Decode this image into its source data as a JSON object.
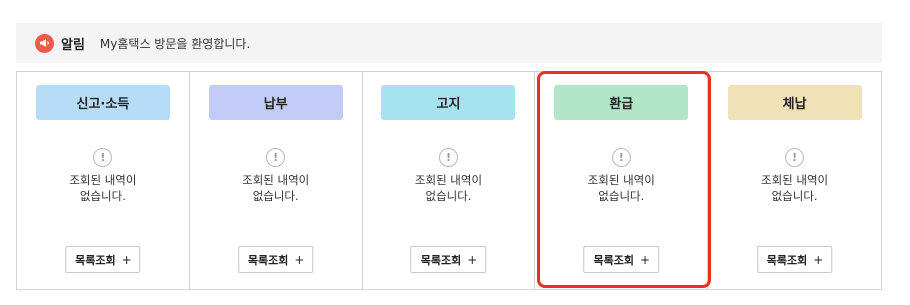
{
  "notice": {
    "icon": "megaphone-icon",
    "title": "알림",
    "message": "My홈택스 방문을 환영합니다."
  },
  "panels": [
    {
      "title": "신고·소득",
      "color": "#b7dcf7",
      "message_line1": "조회된 내역이",
      "message_line2": "없습니다.",
      "button": "목록조회",
      "button_plus": "+"
    },
    {
      "title": "납부",
      "color": "#c3ccf8",
      "message_line1": "조회된 내역이",
      "message_line2": "없습니다.",
      "button": "목록조회",
      "button_plus": "+"
    },
    {
      "title": "고지",
      "color": "#a7e3ef",
      "message_line1": "조회된 내역이",
      "message_line2": "없습니다.",
      "button": "목록조회",
      "button_plus": "+"
    },
    {
      "title": "환급",
      "color": "#b2e6c8",
      "message_line1": "조회된 내역이",
      "message_line2": "없습니다.",
      "button": "목록조회",
      "button_plus": "+"
    },
    {
      "title": "체납",
      "color": "#f1e1b6",
      "message_line1": "조회된 내역이",
      "message_line2": "없습니다.",
      "button": "목록조회",
      "button_plus": "+"
    }
  ],
  "info_icon_glyph": "!",
  "highlight_color": "#e8321e"
}
